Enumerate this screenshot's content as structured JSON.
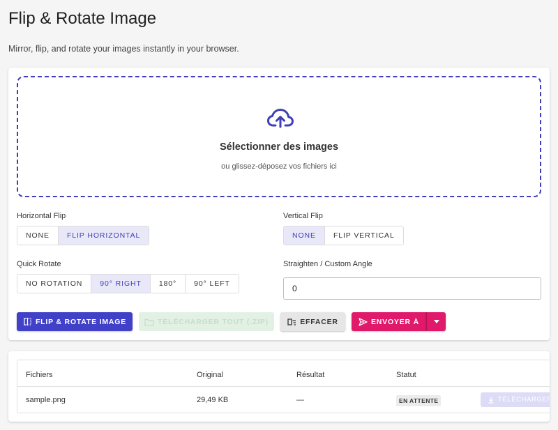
{
  "page": {
    "title": "Flip & Rotate Image",
    "subtitle": "Mirror, flip, and rotate your images instantly in your browser."
  },
  "dropzone": {
    "title": "Sélectionner des images",
    "subtitle": "ou glissez-déposez vos fichiers ici",
    "icon": "cloud-upload-icon"
  },
  "horizontal_flip": {
    "label": "Horizontal Flip",
    "options": [
      "NONE",
      "FLIP HORIZONTAL"
    ],
    "selected": "FLIP HORIZONTAL"
  },
  "vertical_flip": {
    "label": "Vertical Flip",
    "options": [
      "NONE",
      "FLIP VERTICAL"
    ],
    "selected": "NONE"
  },
  "quick_rotate": {
    "label": "Quick Rotate",
    "options": [
      "NO ROTATION",
      "90° RIGHT",
      "180°",
      "90° LEFT"
    ],
    "selected": "90° RIGHT"
  },
  "custom_angle": {
    "label": "Straighten / Custom Angle",
    "value": "0"
  },
  "actions": {
    "primary": "FLIP & ROTATE IMAGE",
    "download_zip": "TÉLÉCHARGER TOUT (.ZIP)",
    "clear": "EFFACER",
    "send_to": "ENVOYER À"
  },
  "table": {
    "headers": [
      "Fichiers",
      "Original",
      "Résultat",
      "Statut"
    ],
    "rows": [
      {
        "file": "sample.png",
        "original": "29,49 KB",
        "result": "—",
        "status": "EN ATTENTE",
        "download": "TÉLÉCHARGER"
      }
    ]
  },
  "colors": {
    "accent": "#4040c8",
    "send": "#e0196b",
    "zip_disabled": "#e2f1e4"
  }
}
